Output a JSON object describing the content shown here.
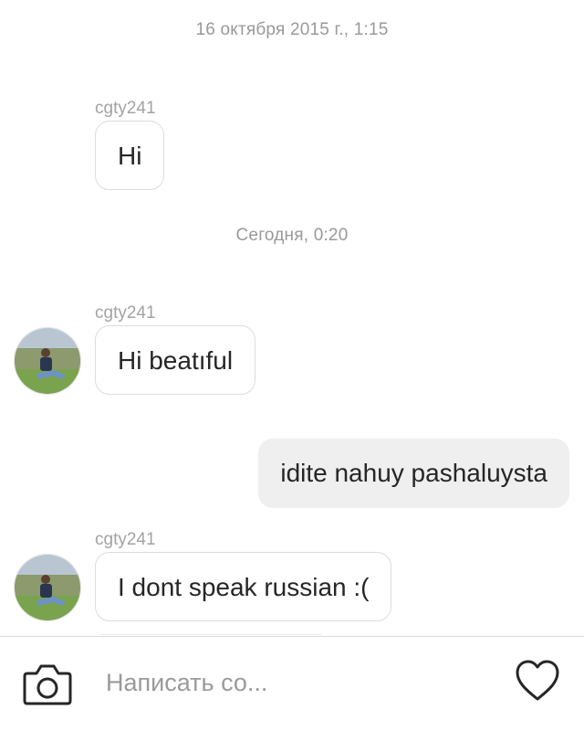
{
  "thread": {
    "timestamps": [
      "16 октября 2015 г., 1:15",
      "Сегодня, 0:20"
    ],
    "messages": [
      {
        "sender": "cgty241",
        "text": "Hi",
        "direction": "incoming"
      },
      {
        "sender": "cgty241",
        "text": "Hi beatıful",
        "direction": "incoming"
      },
      {
        "sender": "",
        "text": "idite nahuy pashaluysta",
        "direction": "outgoing"
      },
      {
        "sender": "cgty241",
        "text": "I dont speak russian :(",
        "direction": "incoming"
      }
    ]
  },
  "composer": {
    "placeholder": "Написать со...",
    "value": "",
    "camera_icon": "camera-icon",
    "like_icon": "heart-icon"
  },
  "colors": {
    "incoming_bubble_border": "#dcdcdc",
    "outgoing_bubble_bg": "#efefef",
    "timestamp_text": "#999999",
    "sender_text": "#a3a3a3"
  }
}
